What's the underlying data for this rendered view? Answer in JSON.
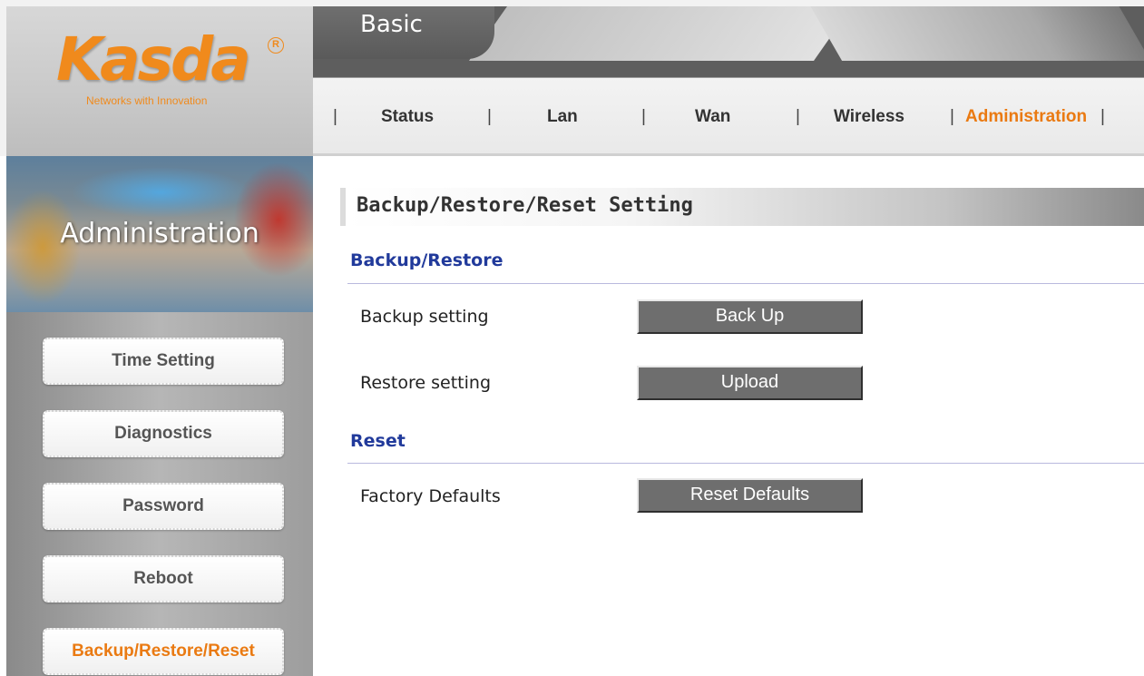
{
  "logo": {
    "brand": "Kasda",
    "registered": "R",
    "tagline": "Networks with Innovation"
  },
  "header": {
    "title": "Basic"
  },
  "nav": {
    "separator": "|",
    "items": [
      {
        "label": "Status",
        "active": false
      },
      {
        "label": "Lan",
        "active": false
      },
      {
        "label": "Wan",
        "active": false
      },
      {
        "label": "Wireless",
        "active": false
      },
      {
        "label": "Administration",
        "active": true
      }
    ]
  },
  "sidebar": {
    "title": "Administration",
    "items": [
      {
        "label": "Time Setting",
        "active": false
      },
      {
        "label": "Diagnostics",
        "active": false
      },
      {
        "label": "Password",
        "active": false
      },
      {
        "label": "Reboot",
        "active": false
      },
      {
        "label": "Backup/Restore/Reset",
        "active": true
      }
    ]
  },
  "main": {
    "section_title": "Backup/Restore/Reset Setting",
    "groups": [
      {
        "title": "Backup/Restore",
        "rows": [
          {
            "label": "Backup setting",
            "button": "Back Up"
          },
          {
            "label": "Restore setting",
            "button": "Upload"
          }
        ]
      },
      {
        "title": "Reset",
        "rows": [
          {
            "label": "Factory Defaults",
            "button": "Reset Defaults"
          }
        ]
      }
    ]
  },
  "colors": {
    "accent": "#ea7a12",
    "group_title": "#213a9b",
    "button_bg": "#6e6e6e"
  }
}
